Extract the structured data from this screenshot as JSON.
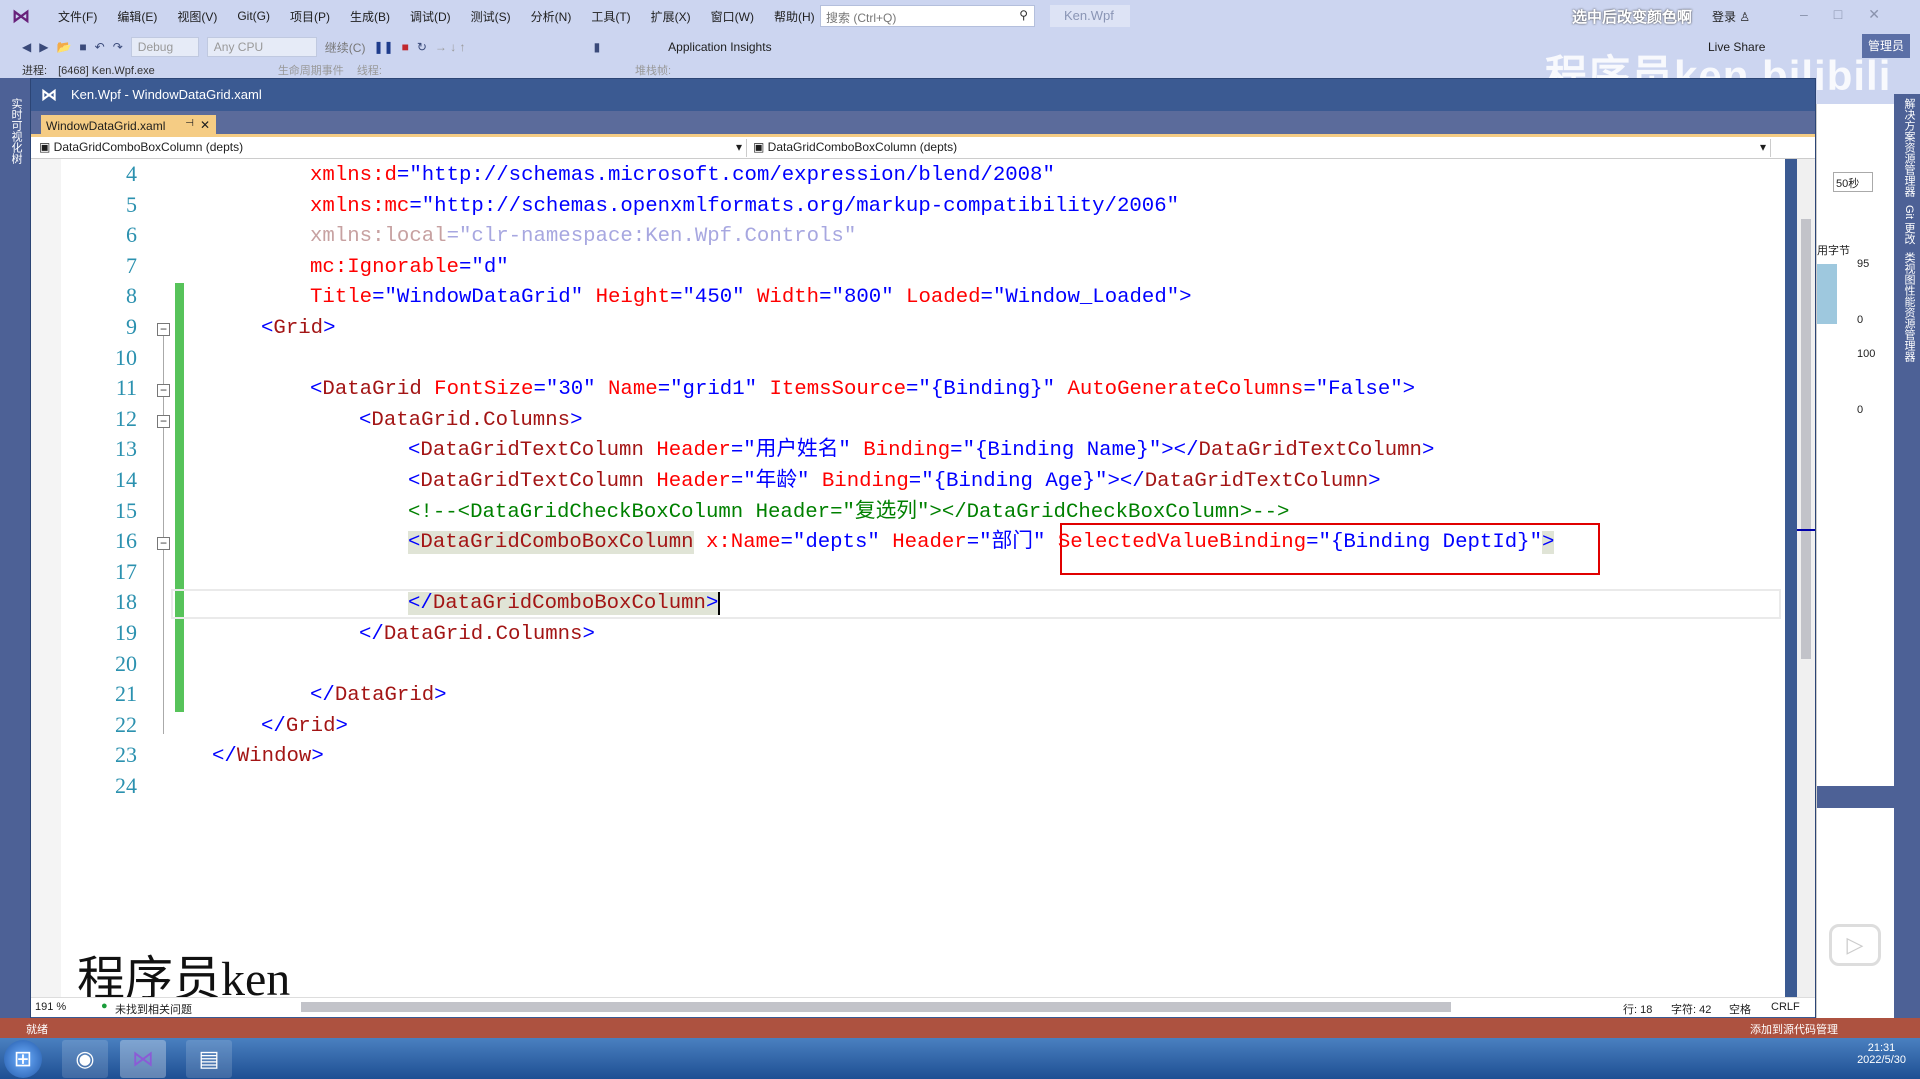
{
  "menubar": {
    "items": [
      "文件(F)",
      "编辑(E)",
      "视图(V)",
      "Git(G)",
      "项目(P)",
      "生成(B)",
      "调试(D)",
      "测试(S)",
      "分析(N)",
      "工具(T)",
      "扩展(X)",
      "窗口(W)",
      "帮助(H)"
    ],
    "search_placeholder": "搜索 (Ctrl+Q)",
    "project": "Ken.Wpf",
    "hint": "选中后改变颜色啊",
    "login": "登录"
  },
  "toolbar": {
    "config": "Debug",
    "platform": "Any CPU",
    "continue": "继续(C)",
    "insights": "Application Insights",
    "live_share": "Live Share",
    "admin": "管理员",
    "process_label": "进程:",
    "process": "[6468] Ken.Wpf.exe",
    "lifecycle": "生命周期事件",
    "thread": "线程:",
    "stack": "堆栈帧:"
  },
  "watermark_top": "程序员ken",
  "side": {
    "left": "实时可视化树",
    "right": [
      "解决方案资源管理器",
      "Git 更改",
      "类视图性能资源管理器"
    ]
  },
  "document": {
    "title": "Ken.Wpf - WindowDataGrid.xaml",
    "tab": "WindowDataGrid.xaml",
    "nav_left": "DataGridComboBoxColumn (depts)",
    "nav_right": "DataGridComboBoxColumn (depts)"
  },
  "code": [
    {
      "n": "4",
      "i": 2,
      "t": [
        [
          "a",
          "xmlns:d"
        ],
        [
          "b",
          "=\""
        ],
        [
          "v",
          "http://schemas.microsoft.com/expression/blend/2008"
        ],
        [
          "b",
          "\""
        ]
      ]
    },
    {
      "n": "5",
      "i": 2,
      "t": [
        [
          "a",
          "xmlns:mc"
        ],
        [
          "b",
          "=\""
        ],
        [
          "v",
          "http://schemas.openxmlformats.org/markup-compatibility/2006"
        ],
        [
          "b",
          "\""
        ]
      ]
    },
    {
      "n": "6",
      "i": 2,
      "t": [
        [
          "f",
          "xmlns:local"
        ],
        [
          "fv",
          "=\"clr-namespace:Ken.Wpf.Controls\""
        ]
      ]
    },
    {
      "n": "7",
      "i": 2,
      "t": [
        [
          "a",
          "mc:Ignorable"
        ],
        [
          "b",
          "=\""
        ],
        [
          "v",
          "d"
        ],
        [
          "b",
          "\""
        ]
      ]
    },
    {
      "n": "8",
      "i": 2,
      "t": [
        [
          "a",
          "Title"
        ],
        [
          "b",
          "=\""
        ],
        [
          "v",
          "WindowDataGrid"
        ],
        [
          "b",
          "\" "
        ],
        [
          "a",
          "Height"
        ],
        [
          "b",
          "=\""
        ],
        [
          "v",
          "450"
        ],
        [
          "b",
          "\" "
        ],
        [
          "a",
          "Width"
        ],
        [
          "b",
          "=\""
        ],
        [
          "v",
          "800"
        ],
        [
          "b",
          "\" "
        ],
        [
          "a",
          "Loaded"
        ],
        [
          "b",
          "=\""
        ],
        [
          "v",
          "Window_Loaded"
        ],
        [
          "b",
          "\">"
        ]
      ]
    },
    {
      "n": "9",
      "i": 1,
      "t": [
        [
          "b",
          "<"
        ],
        [
          "e",
          "Grid"
        ],
        [
          "b",
          ">"
        ]
      ]
    },
    {
      "n": "10",
      "i": 0,
      "t": []
    },
    {
      "n": "11",
      "i": 2,
      "t": [
        [
          "b",
          "<"
        ],
        [
          "e",
          "DataGrid "
        ],
        [
          "a",
          "FontSize"
        ],
        [
          "b",
          "=\""
        ],
        [
          "v",
          "30"
        ],
        [
          "b",
          "\" "
        ],
        [
          "a",
          "Name"
        ],
        [
          "b",
          "=\""
        ],
        [
          "v",
          "grid1"
        ],
        [
          "b",
          "\" "
        ],
        [
          "a",
          "ItemsSource"
        ],
        [
          "b",
          "=\""
        ],
        [
          "v",
          "{Binding}"
        ],
        [
          "b",
          "\" "
        ],
        [
          "a",
          "AutoGenerateColumns"
        ],
        [
          "b",
          "=\""
        ],
        [
          "v",
          "False"
        ],
        [
          "b",
          "\">"
        ]
      ]
    },
    {
      "n": "12",
      "i": 3,
      "t": [
        [
          "b",
          "<"
        ],
        [
          "e",
          "DataGrid.Columns"
        ],
        [
          "b",
          ">"
        ]
      ]
    },
    {
      "n": "13",
      "i": 4,
      "t": [
        [
          "b",
          "<"
        ],
        [
          "e",
          "DataGridTextColumn "
        ],
        [
          "a",
          "Header"
        ],
        [
          "b",
          "=\""
        ],
        [
          "v",
          "用户姓名"
        ],
        [
          "b",
          "\" "
        ],
        [
          "a",
          "Binding"
        ],
        [
          "b",
          "=\""
        ],
        [
          "v",
          "{Binding Name}"
        ],
        [
          "b",
          "\"></"
        ],
        [
          "e",
          "DataGridTextColumn"
        ],
        [
          "b",
          ">"
        ]
      ]
    },
    {
      "n": "14",
      "i": 4,
      "t": [
        [
          "b",
          "<"
        ],
        [
          "e",
          "DataGridTextColumn "
        ],
        [
          "a",
          "Header"
        ],
        [
          "b",
          "=\""
        ],
        [
          "v",
          "年龄"
        ],
        [
          "b",
          "\" "
        ],
        [
          "a",
          "Binding"
        ],
        [
          "b",
          "=\""
        ],
        [
          "v",
          "{Binding Age}"
        ],
        [
          "b",
          "\"></"
        ],
        [
          "e",
          "DataGridTextColumn"
        ],
        [
          "b",
          ">"
        ]
      ]
    },
    {
      "n": "15",
      "i": 4,
      "t": [
        [
          "c",
          "<!--<DataGridCheckBoxColumn Header=\"复选列\"></DataGridCheckBoxColumn>-->"
        ]
      ]
    },
    {
      "n": "16",
      "i": 4,
      "t": [
        [
          "b hl",
          "<"
        ],
        [
          "e hl",
          "DataGridComboBoxColumn"
        ],
        [
          "e",
          " "
        ],
        [
          "a",
          "x:Name"
        ],
        [
          "b",
          "=\""
        ],
        [
          "v",
          "depts"
        ],
        [
          "b",
          "\" "
        ],
        [
          "a",
          "Header"
        ],
        [
          "b",
          "=\""
        ],
        [
          "v",
          "部门"
        ],
        [
          "b",
          "\" "
        ],
        [
          "a",
          "SelectedValueBinding"
        ],
        [
          "b",
          "=\""
        ],
        [
          "v",
          "{Binding DeptId}"
        ],
        [
          "b",
          "\""
        ],
        [
          "b hl",
          ">"
        ]
      ]
    },
    {
      "n": "17",
      "i": 0,
      "t": []
    },
    {
      "n": "18",
      "i": 4,
      "t": [
        [
          "b hl",
          "</"
        ],
        [
          "e hl",
          "DataGridComboBoxColumn"
        ],
        [
          "b hl",
          ">"
        ]
      ]
    },
    {
      "n": "19",
      "i": 3,
      "t": [
        [
          "b",
          "</"
        ],
        [
          "e",
          "DataGrid.Columns"
        ],
        [
          "b",
          ">"
        ]
      ]
    },
    {
      "n": "20",
      "i": 0,
      "t": []
    },
    {
      "n": "21",
      "i": 2,
      "t": [
        [
          "b",
          "</"
        ],
        [
          "e",
          "DataGrid"
        ],
        [
          "b",
          ">"
        ]
      ]
    },
    {
      "n": "22",
      "i": 1,
      "t": [
        [
          "b",
          "</"
        ],
        [
          "e",
          "Grid"
        ],
        [
          "b",
          ">"
        ]
      ]
    },
    {
      "n": "23",
      "i": 0,
      "t": [
        [
          "b",
          "</"
        ],
        [
          "e",
          "Window"
        ],
        [
          "b",
          ">"
        ]
      ]
    },
    {
      "n": "24",
      "i": 0,
      "t": []
    }
  ],
  "watermark": "程序员ken",
  "doc_status": {
    "zoom": "191 %",
    "issues": "未找到相关问题",
    "line": "行: 18",
    "col": "字符: 42",
    "spaces": "空格",
    "eol": "CRLF"
  },
  "right_panel": {
    "input": "50秒",
    "mem_label": "用字节",
    "v1": "95",
    "v2": "0",
    "v3": "100",
    "v4": "0"
  },
  "statusbar": {
    "ready": "就绪",
    "source": "添加到源代码管理"
  },
  "clock": {
    "time": "21:31",
    "date": "2022/5/30"
  },
  "colors": {
    "tag": "#a31515",
    "attr": "#ff0000",
    "value": "#0000ff",
    "comment": "#008000",
    "tab": "#f5cc84",
    "statusbar": "#ad5240",
    "highlight_box": "#e00000"
  }
}
